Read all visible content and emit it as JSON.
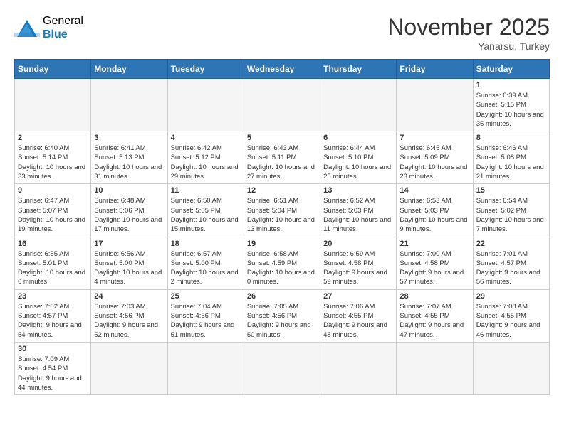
{
  "header": {
    "logo": {
      "general": "General",
      "blue": "Blue"
    },
    "title": "November 2025",
    "location": "Yanarsu, Turkey"
  },
  "weekdays": [
    "Sunday",
    "Monday",
    "Tuesday",
    "Wednesday",
    "Thursday",
    "Friday",
    "Saturday"
  ],
  "weeks": [
    [
      {
        "day": "",
        "info": ""
      },
      {
        "day": "",
        "info": ""
      },
      {
        "day": "",
        "info": ""
      },
      {
        "day": "",
        "info": ""
      },
      {
        "day": "",
        "info": ""
      },
      {
        "day": "",
        "info": ""
      },
      {
        "day": "1",
        "info": "Sunrise: 6:39 AM\nSunset: 5:15 PM\nDaylight: 10 hours and 35 minutes."
      }
    ],
    [
      {
        "day": "2",
        "info": "Sunrise: 6:40 AM\nSunset: 5:14 PM\nDaylight: 10 hours and 33 minutes."
      },
      {
        "day": "3",
        "info": "Sunrise: 6:41 AM\nSunset: 5:13 PM\nDaylight: 10 hours and 31 minutes."
      },
      {
        "day": "4",
        "info": "Sunrise: 6:42 AM\nSunset: 5:12 PM\nDaylight: 10 hours and 29 minutes."
      },
      {
        "day": "5",
        "info": "Sunrise: 6:43 AM\nSunset: 5:11 PM\nDaylight: 10 hours and 27 minutes."
      },
      {
        "day": "6",
        "info": "Sunrise: 6:44 AM\nSunset: 5:10 PM\nDaylight: 10 hours and 25 minutes."
      },
      {
        "day": "7",
        "info": "Sunrise: 6:45 AM\nSunset: 5:09 PM\nDaylight: 10 hours and 23 minutes."
      },
      {
        "day": "8",
        "info": "Sunrise: 6:46 AM\nSunset: 5:08 PM\nDaylight: 10 hours and 21 minutes."
      }
    ],
    [
      {
        "day": "9",
        "info": "Sunrise: 6:47 AM\nSunset: 5:07 PM\nDaylight: 10 hours and 19 minutes."
      },
      {
        "day": "10",
        "info": "Sunrise: 6:48 AM\nSunset: 5:06 PM\nDaylight: 10 hours and 17 minutes."
      },
      {
        "day": "11",
        "info": "Sunrise: 6:50 AM\nSunset: 5:05 PM\nDaylight: 10 hours and 15 minutes."
      },
      {
        "day": "12",
        "info": "Sunrise: 6:51 AM\nSunset: 5:04 PM\nDaylight: 10 hours and 13 minutes."
      },
      {
        "day": "13",
        "info": "Sunrise: 6:52 AM\nSunset: 5:03 PM\nDaylight: 10 hours and 11 minutes."
      },
      {
        "day": "14",
        "info": "Sunrise: 6:53 AM\nSunset: 5:03 PM\nDaylight: 10 hours and 9 minutes."
      },
      {
        "day": "15",
        "info": "Sunrise: 6:54 AM\nSunset: 5:02 PM\nDaylight: 10 hours and 7 minutes."
      }
    ],
    [
      {
        "day": "16",
        "info": "Sunrise: 6:55 AM\nSunset: 5:01 PM\nDaylight: 10 hours and 6 minutes."
      },
      {
        "day": "17",
        "info": "Sunrise: 6:56 AM\nSunset: 5:00 PM\nDaylight: 10 hours and 4 minutes."
      },
      {
        "day": "18",
        "info": "Sunrise: 6:57 AM\nSunset: 5:00 PM\nDaylight: 10 hours and 2 minutes."
      },
      {
        "day": "19",
        "info": "Sunrise: 6:58 AM\nSunset: 4:59 PM\nDaylight: 10 hours and 0 minutes."
      },
      {
        "day": "20",
        "info": "Sunrise: 6:59 AM\nSunset: 4:58 PM\nDaylight: 9 hours and 59 minutes."
      },
      {
        "day": "21",
        "info": "Sunrise: 7:00 AM\nSunset: 4:58 PM\nDaylight: 9 hours and 57 minutes."
      },
      {
        "day": "22",
        "info": "Sunrise: 7:01 AM\nSunset: 4:57 PM\nDaylight: 9 hours and 56 minutes."
      }
    ],
    [
      {
        "day": "23",
        "info": "Sunrise: 7:02 AM\nSunset: 4:57 PM\nDaylight: 9 hours and 54 minutes."
      },
      {
        "day": "24",
        "info": "Sunrise: 7:03 AM\nSunset: 4:56 PM\nDaylight: 9 hours and 52 minutes."
      },
      {
        "day": "25",
        "info": "Sunrise: 7:04 AM\nSunset: 4:56 PM\nDaylight: 9 hours and 51 minutes."
      },
      {
        "day": "26",
        "info": "Sunrise: 7:05 AM\nSunset: 4:56 PM\nDaylight: 9 hours and 50 minutes."
      },
      {
        "day": "27",
        "info": "Sunrise: 7:06 AM\nSunset: 4:55 PM\nDaylight: 9 hours and 48 minutes."
      },
      {
        "day": "28",
        "info": "Sunrise: 7:07 AM\nSunset: 4:55 PM\nDaylight: 9 hours and 47 minutes."
      },
      {
        "day": "29",
        "info": "Sunrise: 7:08 AM\nSunset: 4:55 PM\nDaylight: 9 hours and 46 minutes."
      }
    ],
    [
      {
        "day": "30",
        "info": "Sunrise: 7:09 AM\nSunset: 4:54 PM\nDaylight: 9 hours and 44 minutes."
      },
      {
        "day": "",
        "info": ""
      },
      {
        "day": "",
        "info": ""
      },
      {
        "day": "",
        "info": ""
      },
      {
        "day": "",
        "info": ""
      },
      {
        "day": "",
        "info": ""
      },
      {
        "day": "",
        "info": ""
      }
    ]
  ]
}
